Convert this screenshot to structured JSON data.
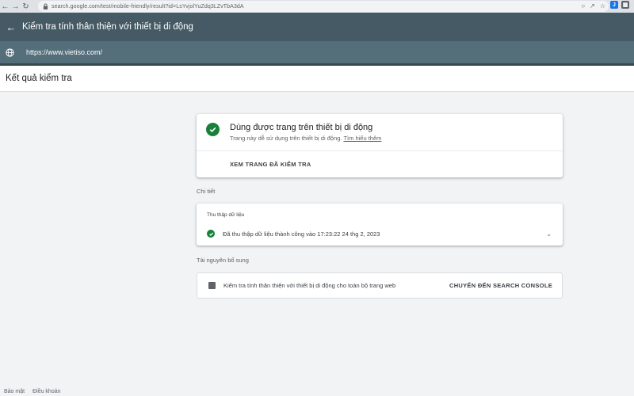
{
  "browser": {
    "url": "search.google.com/test/mobile-friendly/result?id=LsYvjolYuZdq3LZvTbA3dA"
  },
  "header": {
    "title": "Kiểm tra tính thân thiện với thiết bị di động",
    "tested_url": "https://www.vietiso.com/"
  },
  "results": {
    "title": "Kết quả kiểm tra"
  },
  "main_card": {
    "title": "Dùng được trang trên thiết bị di động",
    "subtitle": "Trang này dễ sử dụng trên thiết bị di động.",
    "learn_more": "Tìm hiểu thêm",
    "view_tested": "XEM TRANG ĐÃ KIỂM TRA"
  },
  "details": {
    "label": "Chi tiết",
    "collect_title": "Thu thập dữ liệu",
    "collect_text": "Đã thu thập dữ liệu thành công vào 17:23:22 24 thg 2, 2023"
  },
  "resources": {
    "label": "Tài nguyên bổ sung",
    "text": "Kiểm tra tính thân thiện với thiết bị di động cho toàn bộ trang web",
    "link": "CHUYỂN ĐẾN SEARCH CONSOLE"
  },
  "footer": {
    "privacy": "Bảo mật",
    "terms": "Điều khoản"
  },
  "colors": {
    "header": "#455a64",
    "url_bar": "#546e7a",
    "success": "#188038"
  }
}
